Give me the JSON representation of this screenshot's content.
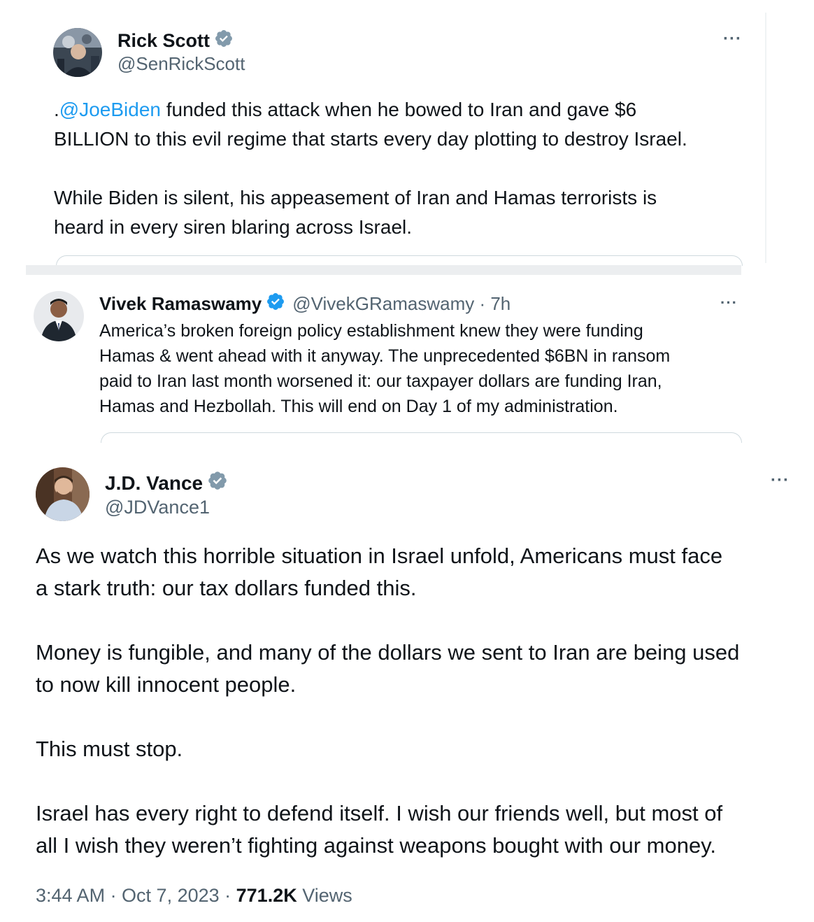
{
  "tweets": [
    {
      "name": "Rick Scott",
      "handle": "@SenRickScott",
      "mention": "@JoeBiden",
      "text_prefix": ".",
      "text_after_mention": " funded this attack when he bowed to Iran and gave $6\nBILLION to this evil regime that starts every day plotting to destroy Israel.\n\nWhile Biden is silent, his appeasement of Iran and Hamas terrorists is\nheard in every siren blaring across Israel.",
      "more_label": "···"
    },
    {
      "name": "Vivek Ramaswamy",
      "handle_time": "@VivekGRamaswamy · 7h",
      "text": "America’s broken foreign policy establishment knew they were funding\nHamas & went ahead with it anyway. The unprecedented $6BN in ransom\npaid to Iran last month worsened it: our taxpayer dollars are funding Iran,\nHamas and Hezbollah. This will end on Day 1 of my administration.",
      "more_label": "···"
    },
    {
      "name": "J.D. Vance",
      "handle": "@JDVance1",
      "text": "As we watch this horrible situation in Israel unfold, Americans must face\na stark truth: our tax dollars funded this.\n\nMoney is fungible, and many of the dollars we sent to Iran are being used\nto now kill innocent people.\n\nThis must stop.\n\nIsrael has every right to defend itself. I wish our friends well, but most of\nall I wish they weren’t fighting against weapons bought with our money.",
      "time_date": "3:44 AM · Oct 7, 2023 · ",
      "views_count": "771.2K",
      "views_label": " Views",
      "more_label": "···"
    }
  ],
  "colors": {
    "link": "#1d9bf0",
    "verified_gray": "#829aab",
    "verified_blue": "#1d9bf0",
    "secondary_text": "#536471"
  }
}
